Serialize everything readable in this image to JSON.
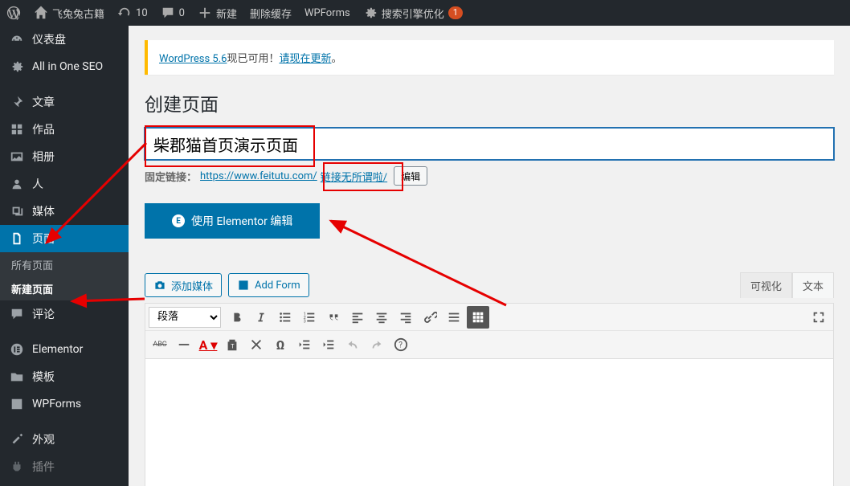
{
  "adminbar": {
    "site_title": "飞兔兔古籍",
    "updates_count": "10",
    "comments_count": "0",
    "new_label": "新建",
    "cache_label": "删除缓存",
    "wpforms_label": "WPForms",
    "seo_label": "搜索引擎优化",
    "seo_badge": "1"
  },
  "sidebar": {
    "dashboard": "仪表盘",
    "aioseo": "All in One SEO",
    "posts": "文章",
    "works": "作品",
    "albums": "相册",
    "people": "人",
    "media": "媒体",
    "pages": "页面",
    "all_pages": "所有页面",
    "new_page": "新建页面",
    "comments": "评论",
    "elementor": "Elementor",
    "templates": "模板",
    "wpforms": "WPForms",
    "appearance": "外观",
    "plugins": "插件"
  },
  "content": {
    "notice_pre": "WordPress 5.6",
    "notice_mid": "现已可用！",
    "notice_link": "请现在更新",
    "heading": "创建页面",
    "title_value": "柴郡猫首页演示页面",
    "permalink_label": "固定链接：",
    "permalink_url": "https://www.feitutu.com/",
    "permalink_slug": "链接无所谓啦/",
    "permalink_edit": "编辑",
    "elementor_btn": "使用 Elementor 编辑",
    "add_media": "添加媒体",
    "add_form": "Add Form",
    "tab_visual": "可视化",
    "tab_text": "文本",
    "format_select": "段落",
    "abc_label": "ABC"
  }
}
